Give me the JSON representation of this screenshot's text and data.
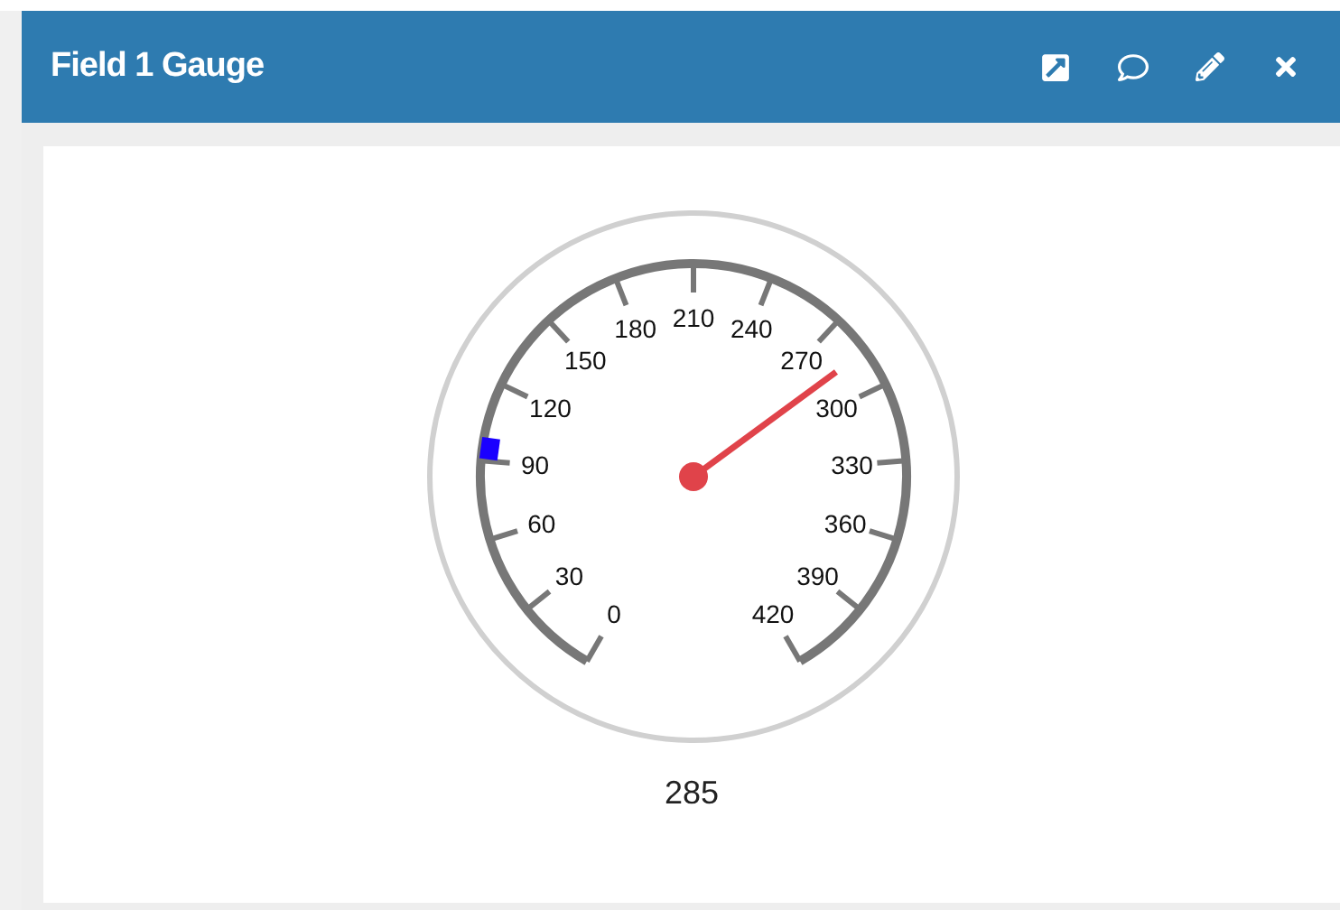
{
  "header": {
    "title": "Field 1 Gauge"
  },
  "gauge": {
    "top_label": "210",
    "left_labels": [
      "180",
      "150",
      "120",
      "90",
      "60",
      "30",
      "0"
    ],
    "right_labels": [
      "240",
      "270",
      "300",
      "330",
      "360",
      "390",
      "420"
    ],
    "value": "285"
  }
}
